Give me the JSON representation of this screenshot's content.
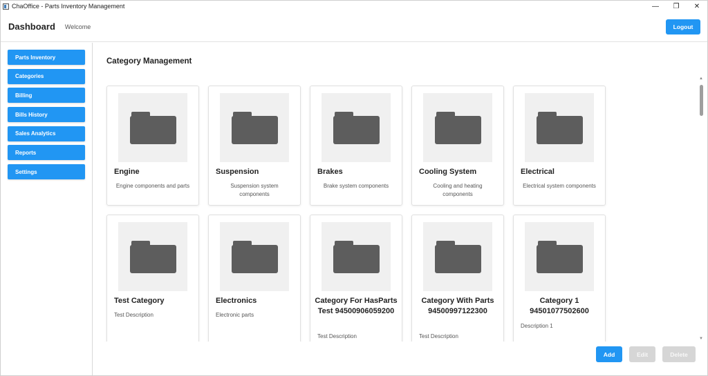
{
  "window": {
    "title": "ChaOffice - Parts Inventory Management",
    "controls": {
      "minimize": "—",
      "maximize": "❐",
      "close": "✕"
    }
  },
  "header": {
    "title": "Dashboard",
    "welcome": "Welcome",
    "logout_label": "Logout"
  },
  "sidebar": {
    "items": [
      {
        "label": "Parts Inventory"
      },
      {
        "label": "Categories"
      },
      {
        "label": "Billing"
      },
      {
        "label": "Bills History"
      },
      {
        "label": "Sales Analytics"
      },
      {
        "label": "Reports"
      },
      {
        "label": "Settings"
      }
    ]
  },
  "main": {
    "title": "Category Management",
    "categories": [
      {
        "name": "Engine",
        "description": "Engine components and parts",
        "icon": "folder-icon"
      },
      {
        "name": "Suspension",
        "description": "Suspension system components",
        "icon": "folder-icon"
      },
      {
        "name": "Brakes",
        "description": "Brake system components",
        "icon": "folder-icon"
      },
      {
        "name": "Cooling System",
        "description": "Cooling and heating components",
        "icon": "folder-icon"
      },
      {
        "name": "Electrical",
        "description": "Electrical system components",
        "icon": "folder-icon"
      },
      {
        "name": "Test Category",
        "description": "Test Description",
        "icon": "folder-icon"
      },
      {
        "name": "Electronics",
        "description": "Electronic parts",
        "icon": "folder-icon"
      },
      {
        "name": "Category For HasParts Test 94500906059200",
        "description": "Test Description",
        "icon": "folder-icon"
      },
      {
        "name": "Category With Parts 94500997122300",
        "description": "Test Description",
        "icon": "folder-icon"
      },
      {
        "name": "Category 1 94501077502600",
        "description": "Description 1",
        "icon": "folder-icon"
      }
    ]
  },
  "actions": {
    "add_label": "Add",
    "edit_label": "Edit",
    "delete_label": "Delete"
  },
  "colors": {
    "accent": "#2196f3",
    "disabled": "#d6d6d6",
    "folder": "#5d5d5d",
    "thumb_bg": "#f0f0f0"
  }
}
